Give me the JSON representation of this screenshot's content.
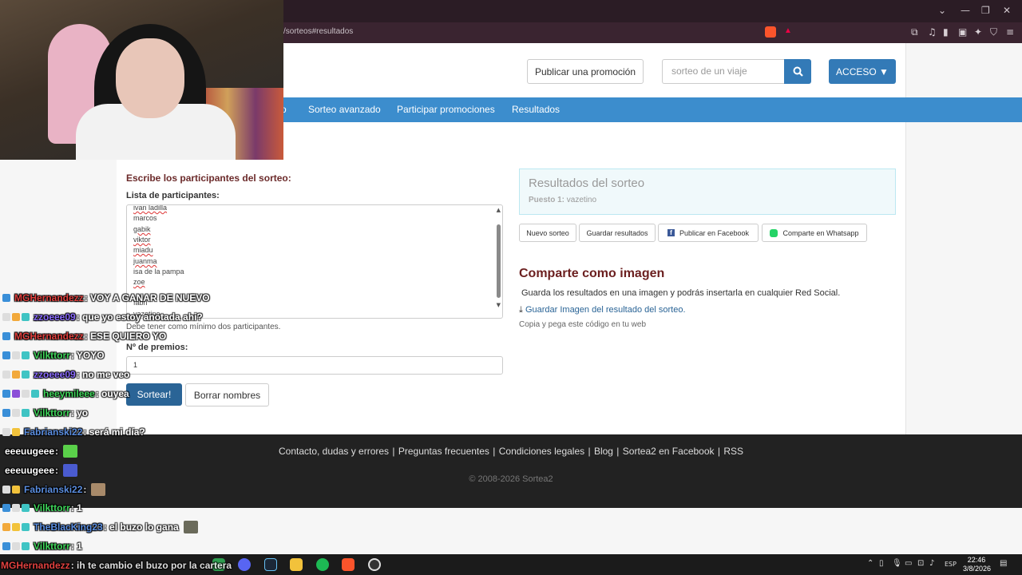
{
  "browser": {
    "url": "/sorteos#resultados",
    "window_controls": [
      "⌄",
      "—",
      "❐",
      "✕"
    ]
  },
  "header": {
    "publish_button": "Publicar una promoción",
    "search_placeholder": "sorteo de un viaje",
    "access_button": "ACCESO ▼"
  },
  "nav": {
    "items": [
      "o",
      "Sorteo avanzado",
      "Participar promociones",
      "Resultados"
    ]
  },
  "form": {
    "section_title": "Escribe los participantes del sorteo:",
    "participants_label": "Lista de participantes:",
    "participants": [
      "ivan ladilla",
      "marcos",
      "gabik",
      "viktor",
      "miadu",
      "juanma",
      "isa de la pampa",
      "zoe",
      "fabri",
      "vazetino"
    ],
    "min_hint": "Debe tener como mínimo dos participantes.",
    "prizes_label": "Nº de premios:",
    "prizes_value": "1",
    "draw_button": "Sortear!",
    "clear_button": "Borrar nombres"
  },
  "results": {
    "title": "Resultados del sorteo",
    "position_label": "Puesto 1:",
    "position_value": "vazetino",
    "buttons": {
      "new": "Nuevo sorteo",
      "save": "Guardar resultados",
      "facebook": "Publicar en Facebook",
      "whatsapp": "Comparte en Whatsapp"
    },
    "share_title": "Comparte como imagen",
    "share_desc": "Guarda los resultados en una imagen y podrás insertarla en cualquier Red Social.",
    "save_image_link": "Guardar Imagen del resultado del sorteo.",
    "copy_text": "Copia y pega este código en tu web"
  },
  "footer": {
    "links": [
      "Contacto, dudas y errores",
      "Preguntas frecuentes",
      "Condiciones legales",
      "Blog",
      "Sortea2 en Facebook",
      "RSS"
    ],
    "copyright": "© 2008-2026 Sortea2"
  },
  "chat": [
    {
      "user": "MGHernandezz",
      "color": "#e0413f",
      "msg": ": VOY A GANAR DE NUEVO"
    },
    {
      "user": "zzoeee09",
      "color": "#8b6cff",
      "msg": ": que yo estoy anotada ahi?"
    },
    {
      "user": "MGHernandezz",
      "color": "#e0413f",
      "msg": ": ESE QUIERO YO"
    },
    {
      "user": "Vilkttorr",
      "color": "#3fd65b",
      "msg": ": YOYO"
    },
    {
      "user": "zzoeee09",
      "color": "#8b6cff",
      "msg": ": no me veo"
    },
    {
      "user": "heeymileee",
      "color": "#3fd65b",
      "msg": ": ouyea"
    },
    {
      "user": "Vilkttorr",
      "color": "#3fd65b",
      "msg": ": yo"
    },
    {
      "user": "Fabrianski22",
      "color": "#5b8ee0",
      "msg": ": será mi día?"
    },
    {
      "user": "eeeuugeee",
      "color": "#ffffff",
      "msg": ":"
    },
    {
      "user": "eeeuugeee",
      "color": "#ffffff",
      "msg": ":"
    },
    {
      "user": "Fabrianski22",
      "color": "#5b8ee0",
      "msg": ":"
    },
    {
      "user": "Vilkttorr",
      "color": "#3fd65b",
      "msg": ": 1"
    },
    {
      "user": "TheBlacKing23",
      "color": "#5b8ee0",
      "msg": ": el buzo lo gana"
    },
    {
      "user": "Vilkttorr",
      "color": "#3fd65b",
      "msg": ": 1"
    },
    {
      "user": "MGHernandezz",
      "color": "#e0413f",
      "msg": ": ih te cambio el buzo por la cartera"
    }
  ],
  "taskbar": {
    "lang": "ESP",
    "time": "22:46",
    "date": "3/8/2026"
  }
}
